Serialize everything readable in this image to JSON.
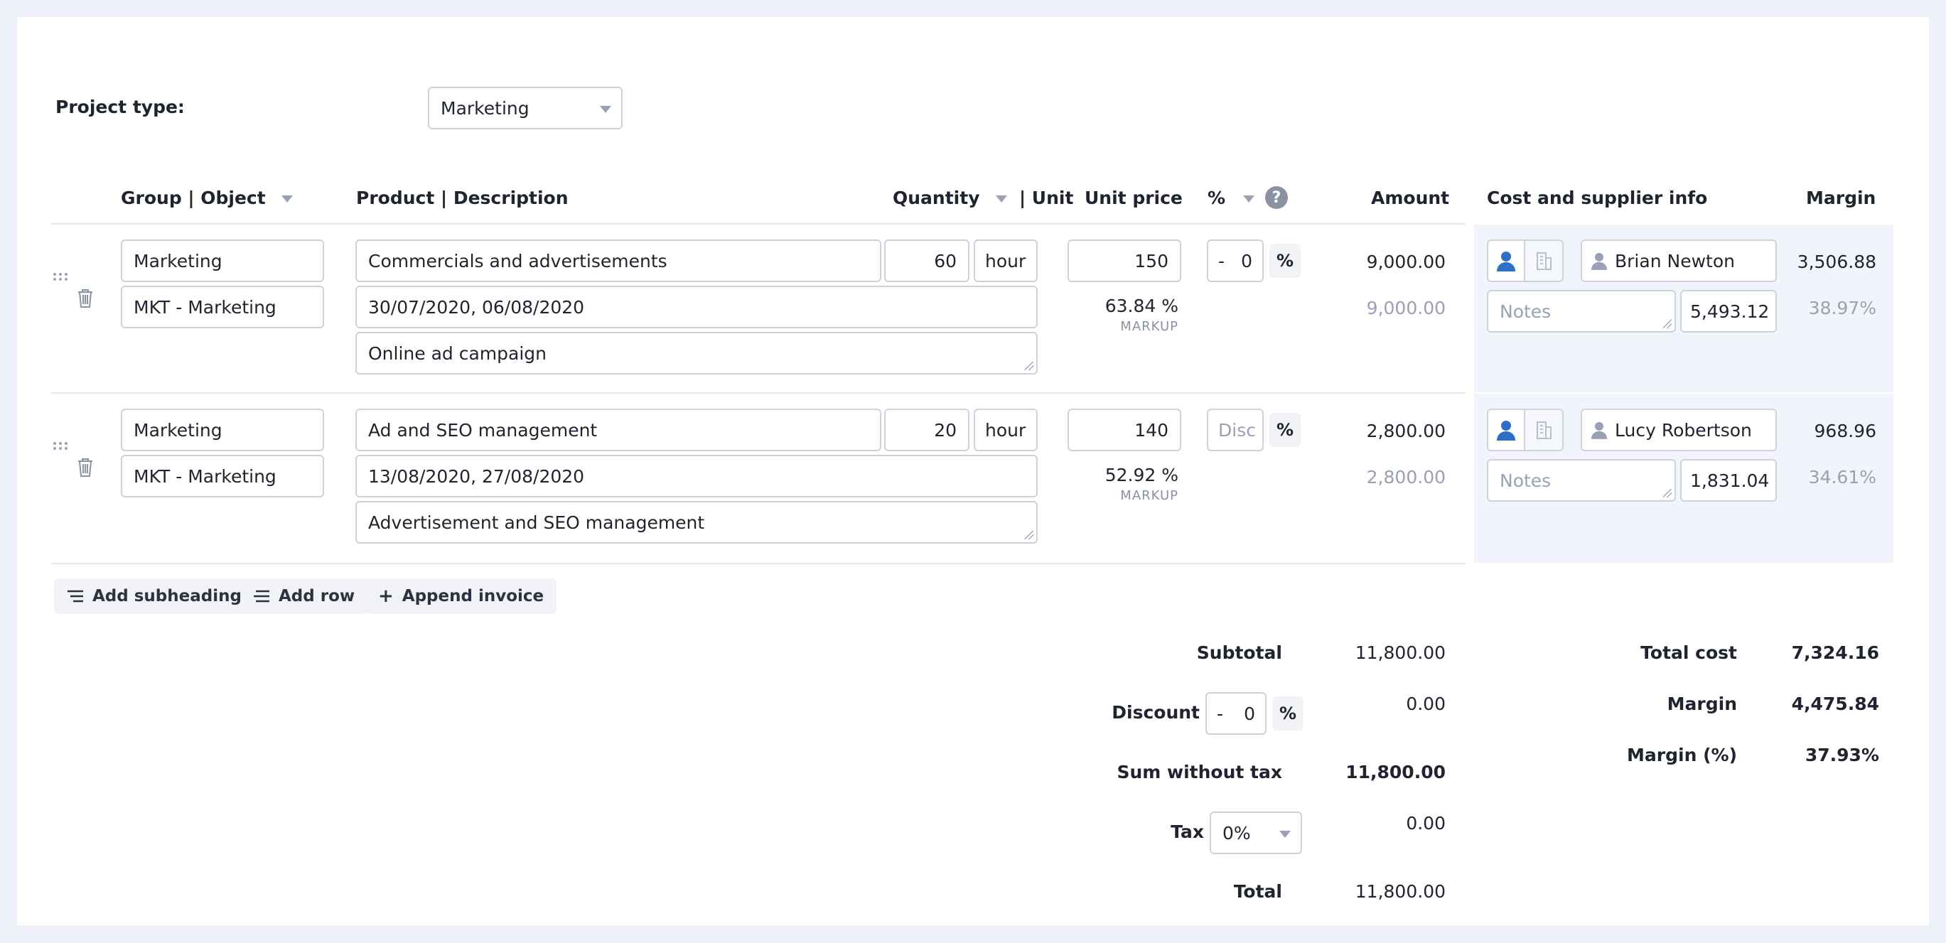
{
  "project": {
    "type_label": "Project type:",
    "type_value": "Marketing"
  },
  "columns": {
    "group_object": "Group | Object",
    "product_description": "Product | Description",
    "quantity": "Quantity",
    "unit": "| Unit",
    "unit_price": "Unit price",
    "discount": "%",
    "amount": "Amount",
    "cost_supplier": "Cost and supplier info",
    "margin": "Margin"
  },
  "rows": [
    {
      "group": "Marketing",
      "object": "MKT - Marketing",
      "product": "Commercials and advertisements",
      "dates": "30/07/2020, 06/08/2020",
      "description": "Online ad campaign",
      "quantity": "60",
      "unit": "hour",
      "unit_price": "150",
      "discount_sign": "-",
      "discount_value": "0",
      "discount_placeholder": "",
      "pct": "%",
      "markup": "63.84 %",
      "markup_label": "MARKUP",
      "amount": "9,000.00",
      "amount_secondary": "9,000.00",
      "supplier": "Brian Newton",
      "notes_placeholder": "Notes",
      "cost": "5,493.12",
      "margin": "3,506.88",
      "margin_pct": "38.97%"
    },
    {
      "group": "Marketing",
      "object": "MKT - Marketing",
      "product": "Ad and SEO management",
      "dates": "13/08/2020, 27/08/2020",
      "description": "Advertisement and SEO management",
      "quantity": "20",
      "unit": "hour",
      "unit_price": "140",
      "discount_sign": "",
      "discount_value": "",
      "discount_placeholder": "Disc",
      "pct": "%",
      "markup": "52.92 %",
      "markup_label": "MARKUP",
      "amount": "2,800.00",
      "amount_secondary": "2,800.00",
      "supplier": "Lucy Robertson",
      "notes_placeholder": "Notes",
      "cost": "1,831.04",
      "margin": "968.96",
      "margin_pct": "34.61%"
    }
  ],
  "actions": {
    "add_subheading": "Add subheading",
    "add_row": "Add row",
    "append_invoice": "Append invoice"
  },
  "totals": {
    "subtotal_label": "Subtotal",
    "subtotal": "11,800.00",
    "discount_label": "Discount",
    "discount_sign": "-",
    "discount_value": "0",
    "discount_pct": "%",
    "discount_amount": "0.00",
    "sum_wo_tax_label": "Sum without tax",
    "sum_wo_tax": "11,800.00",
    "tax_label": "Tax",
    "tax_value": "0%",
    "tax_amount": "0.00",
    "total_label": "Total",
    "total": "11,800.00"
  },
  "cost_totals": {
    "total_cost_label": "Total cost",
    "total_cost": "7,324.16",
    "margin_label": "Margin",
    "margin": "4,475.84",
    "margin_pct_label": "Margin (%)",
    "margin_pct": "37.93%"
  },
  "icons": {
    "drag": "drag-handle-icon",
    "delete": "trash-icon",
    "person": "person-icon",
    "company": "building-icon",
    "help": "help-icon"
  }
}
